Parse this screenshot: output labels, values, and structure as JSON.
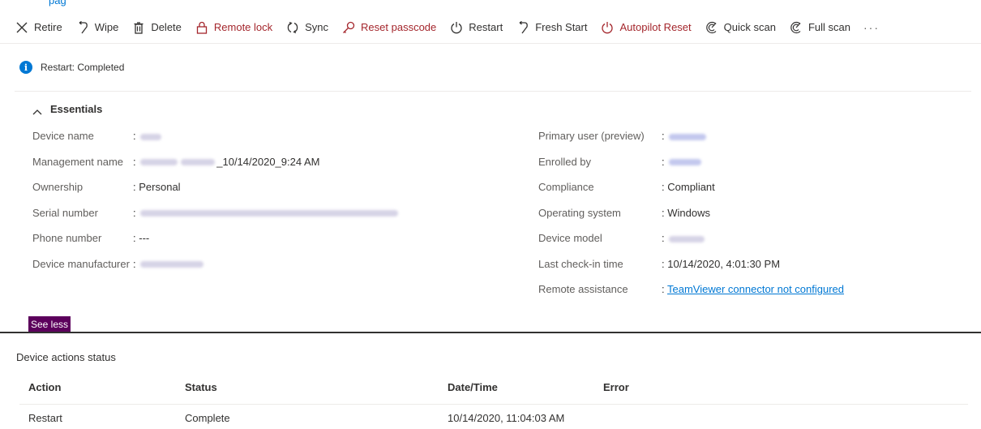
{
  "toolbar": {
    "items": [
      {
        "label": "Retire",
        "icon": "close-icon"
      },
      {
        "label": "Wipe",
        "icon": "wipe-icon"
      },
      {
        "label": "Delete",
        "icon": "trash-icon"
      },
      {
        "label": "Remote lock",
        "icon": "lock-icon"
      },
      {
        "label": "Sync",
        "icon": "sync-icon"
      },
      {
        "label": "Reset passcode",
        "icon": "key-icon"
      },
      {
        "label": "Restart",
        "icon": "power-icon"
      },
      {
        "label": "Fresh Start",
        "icon": "fresh-start-icon"
      },
      {
        "label": "Autopilot Reset",
        "icon": "power-icon"
      },
      {
        "label": "Quick scan",
        "icon": "scan-icon"
      },
      {
        "label": "Full scan",
        "icon": "scan-icon"
      }
    ],
    "more": "···"
  },
  "notice": "Restart: Completed",
  "essentials": {
    "title": "Essentials",
    "left": [
      {
        "key": "Device name",
        "sep": ":",
        "value": ""
      },
      {
        "key": "Management name",
        "sep": ":",
        "value": "_10/14/2020_9:24 AM"
      },
      {
        "key": "Ownership",
        "sep": ":",
        "value": "Personal"
      },
      {
        "key": "Serial number",
        "sep": ":",
        "value": ""
      },
      {
        "key": "Phone number",
        "sep": ":",
        "value": "---"
      },
      {
        "key": "Device manufacturer",
        "sep": ":",
        "value": ""
      }
    ],
    "right": [
      {
        "key": "Primary user (preview)",
        "sep": ":",
        "value": ""
      },
      {
        "key": "Enrolled by",
        "sep": ":",
        "value": ""
      },
      {
        "key": "Compliance",
        "sep": ":",
        "value": "Compliant"
      },
      {
        "key": "Operating system",
        "sep": ":",
        "value": "Windows"
      },
      {
        "key": "Device model",
        "sep": ":",
        "value": ""
      },
      {
        "key": "Last check-in time",
        "sep": ":",
        "value": "10/14/2020, 4:01:30 PM"
      },
      {
        "key": "Remote assistance",
        "sep": ":",
        "value": "TeamViewer connector not configured"
      }
    ]
  },
  "see_less": "See less",
  "device_actions": {
    "title": "Device actions status",
    "columns": [
      "Action",
      "Status",
      "Date/Time",
      "Error"
    ],
    "rows": [
      {
        "action": "Restart",
        "status": "Complete",
        "datetime": "10/14/2020, 11:04:03 AM",
        "error": ""
      }
    ]
  },
  "colors": {
    "accent": "#0078d4",
    "danger": "#a4262c",
    "see_less_bg": "#5c005c"
  }
}
